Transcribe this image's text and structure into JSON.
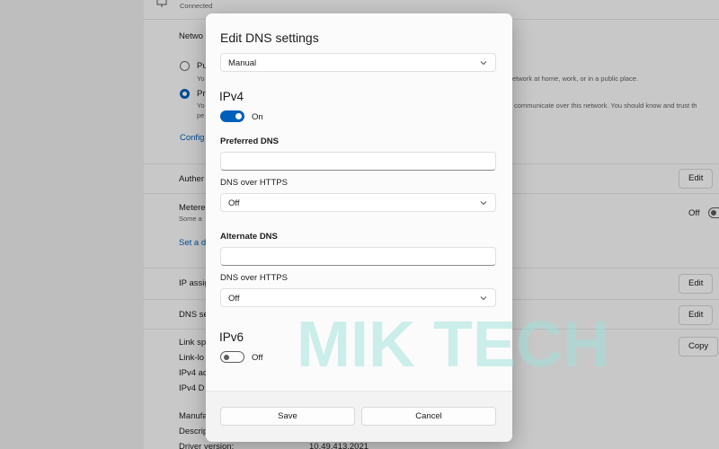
{
  "background": {
    "connected_text": "Connected",
    "network_profile_label": "Netwo",
    "public_option": "Pu",
    "public_sub": "Yo",
    "public_desc": "etwork at home, work, or in a public place.",
    "private_option": "Pr",
    "private_sub": "Yo",
    "private_sub2": "pe",
    "private_desc": "communicate over this network. You should know and trust th",
    "configure_link": "Config",
    "authentication_label": "Auther",
    "authentication_edit": "Edit",
    "metered_label": "Metere",
    "metered_sub": "Some a",
    "metered_state": "Off",
    "set_data_link": "Set a d",
    "ip_assignment_label": "IP assig",
    "ip_assignment_edit": "Edit",
    "dns_server_label": "DNS se",
    "dns_server_edit": "Edit",
    "link_speed_label": "Link sp",
    "link_local_label": "Link-lo",
    "ipv4_address_label": "IPv4 ac",
    "ipv4_dns_label": "IPv4 D",
    "copy_button": "Copy",
    "manufacturer_label": "Manufa",
    "description_label": "Descrip",
    "driver_version_label": "Driver version:",
    "driver_version_value": "10.49.413.2021"
  },
  "dialog": {
    "title": "Edit DNS settings",
    "mode_select": "Manual",
    "ipv4": {
      "heading": "IPv4",
      "toggle_state": "On",
      "preferred_dns_label": "Preferred DNS",
      "preferred_dns_value": "",
      "preferred_doh_label": "DNS over HTTPS",
      "preferred_doh_value": "Off",
      "alternate_dns_label": "Alternate DNS",
      "alternate_dns_value": "",
      "alternate_doh_label": "DNS over HTTPS",
      "alternate_doh_value": "Off"
    },
    "ipv6": {
      "heading": "IPv6",
      "toggle_state": "Off"
    },
    "save_label": "Save",
    "cancel_label": "Cancel"
  },
  "watermark": {
    "text": "MIK TECH"
  },
  "colors": {
    "accent": "#005fb8",
    "watermark": "#9ee3dc"
  }
}
